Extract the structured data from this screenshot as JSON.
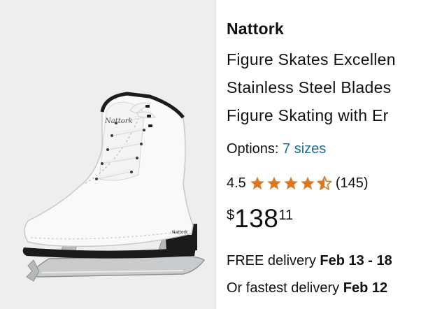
{
  "product": {
    "image_alt": "white figure skate",
    "skate_brand_mark": "Nattork",
    "brand": "Nattork",
    "title_lines": [
      "Figure Skates Excellen",
      "Stainless Steel Blades",
      "Figure Skating with Er"
    ],
    "options_label": "Options:",
    "options_link": "7 sizes",
    "rating_value": "4.5",
    "rating_stars": 4.5,
    "review_count": "(145)",
    "price_symbol": "$",
    "price_whole": "138",
    "price_fraction": "11",
    "delivery_prefix": "FREE delivery",
    "delivery_date": "Feb 13 - 18",
    "fastest_prefix": "Or fastest delivery",
    "fastest_date": "Feb 12"
  },
  "colors": {
    "star": "#de7921",
    "link": "#1f6d97",
    "text": "#0f1111",
    "image_bg": "#eeeeee"
  }
}
